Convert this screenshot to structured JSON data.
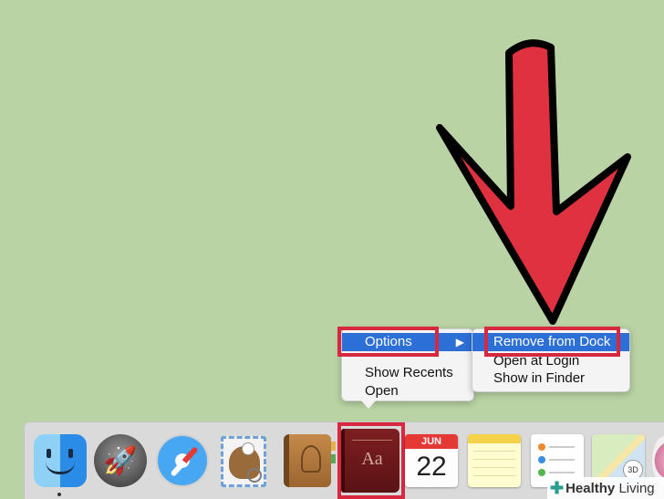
{
  "context_menu": {
    "items": [
      {
        "label": "Options",
        "has_submenu": true,
        "selected": true
      },
      {
        "label": "Show Recents",
        "has_submenu": false,
        "selected": false
      },
      {
        "label": "Open",
        "has_submenu": false,
        "selected": false
      }
    ],
    "submenu_arrow": "▶"
  },
  "submenu": {
    "items": [
      {
        "label": "Remove from Dock",
        "selected": true
      },
      {
        "label": "Open at Login",
        "selected": false
      },
      {
        "label": "Show in Finder",
        "selected": false
      }
    ]
  },
  "dock": {
    "apps": [
      {
        "name": "Finder",
        "icon": "finder-icon",
        "running": true
      },
      {
        "name": "Launchpad",
        "icon": "rocket-icon",
        "running": false
      },
      {
        "name": "Safari",
        "icon": "compass-icon",
        "running": false
      },
      {
        "name": "Mail",
        "icon": "stamp-icon",
        "running": false
      },
      {
        "name": "Contacts",
        "icon": "address-book-icon",
        "running": false
      },
      {
        "name": "Dictionary",
        "icon": "book-icon",
        "running": false,
        "highlighted": true
      },
      {
        "name": "Calendar",
        "icon": "calendar-icon",
        "running": false
      },
      {
        "name": "Notes",
        "icon": "notepad-icon",
        "running": false
      },
      {
        "name": "Reminders",
        "icon": "checklist-icon",
        "running": false
      },
      {
        "name": "Maps",
        "icon": "map-icon",
        "running": false
      },
      {
        "name": "Photos",
        "icon": "flower-icon",
        "running": false
      }
    ],
    "dictionary_glyph": "Aa",
    "calendar_month": "JUN",
    "calendar_day": "22",
    "maps_badge": "3D"
  },
  "watermark": {
    "cross": "✚",
    "brand_bold": "Healthy",
    "brand_light": "Living"
  },
  "colors": {
    "desktop": "#bad3a4",
    "arrow_fill": "#e03141",
    "highlight_border": "#d8283f",
    "menu_selection": "#2c6fd6"
  }
}
